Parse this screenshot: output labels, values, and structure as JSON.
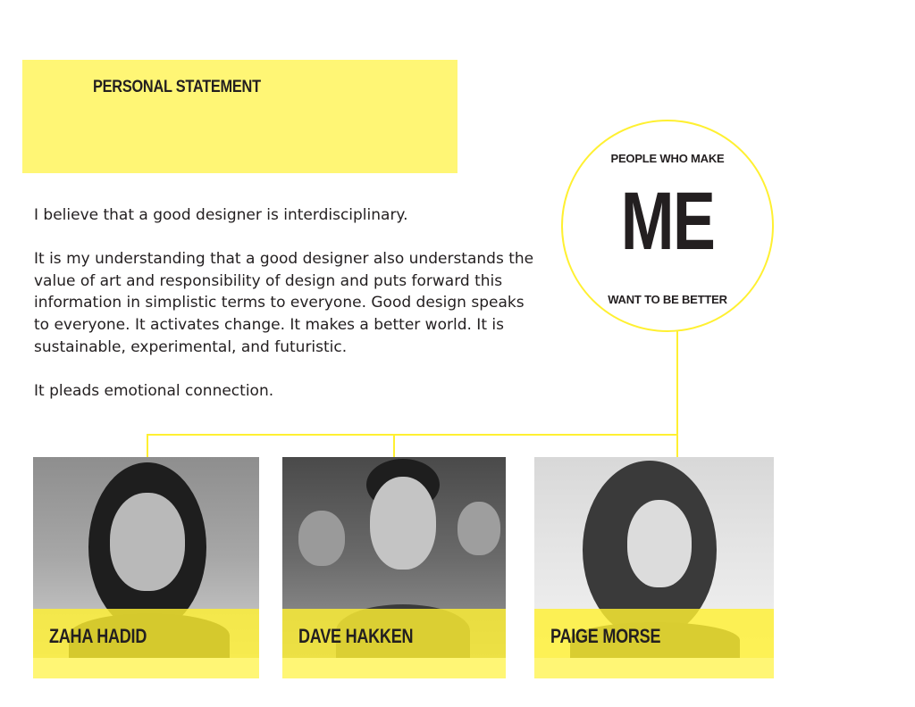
{
  "header": {
    "title": "PERSONAL STATEMENT"
  },
  "statement": {
    "paragraphs": [
      "I believe that a good designer is interdisciplinary.",
      "It is my understanding that a good designer also understands the value of art and responsibility of design and puts forward this information in simplistic terms to everyone. Good design speaks to everyone. It activates change. It makes a better world. It is sustainable, experimental, and futuristic.",
      "It pleads emotional connection."
    ]
  },
  "circle": {
    "top_label": "PEOPLE WHO MAKE",
    "big_text": "ME",
    "bottom_label": "WANT TO BE BETTER"
  },
  "people": [
    {
      "name": "ZAHA HADID"
    },
    {
      "name": "DAVE HAKKEN"
    },
    {
      "name": "PAIGE MORSE"
    }
  ],
  "colors": {
    "accent_fill": "#fff675",
    "accent_line": "#fff031",
    "text": "#231f20"
  }
}
